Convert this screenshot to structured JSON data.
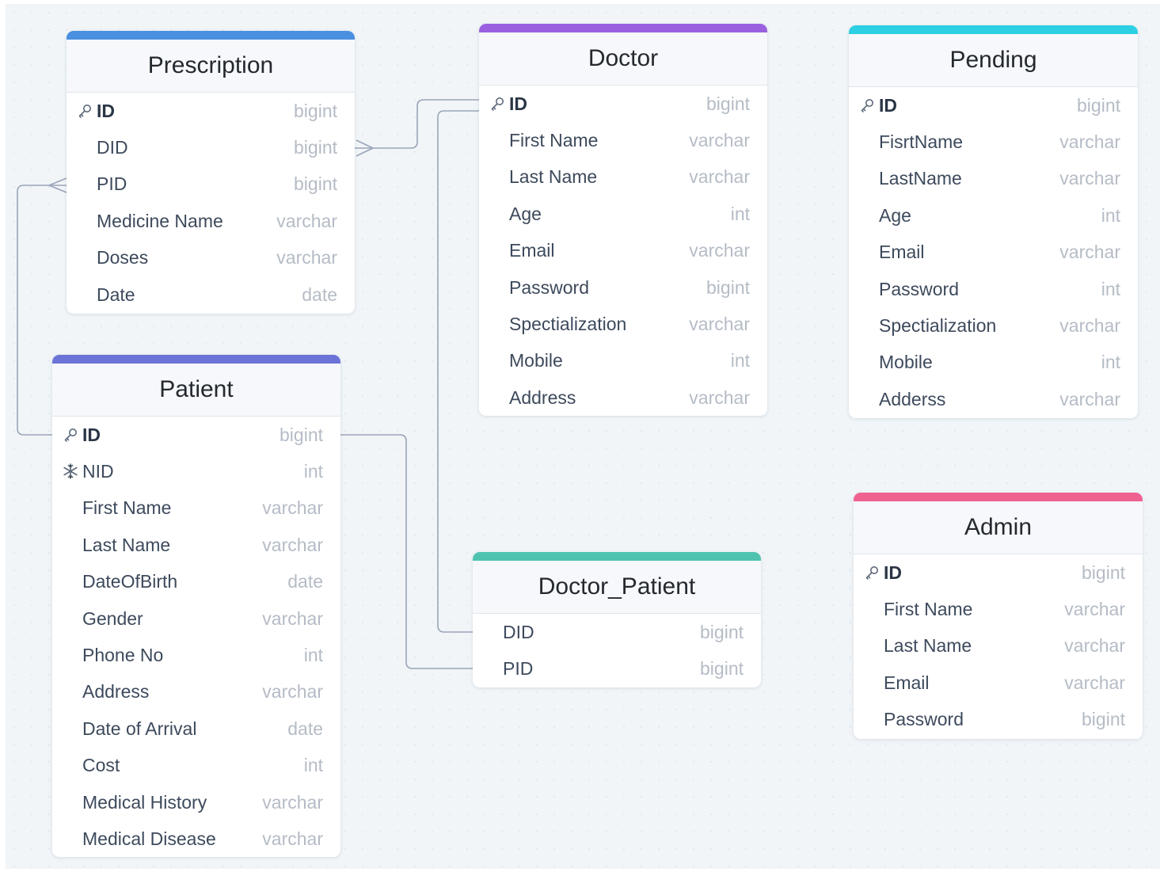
{
  "colors": {
    "background": "#f1f5f8",
    "connector": "#9aa5b8",
    "prescription": "#4a8fe0",
    "doctor": "#9a60e0",
    "pending": "#2ccfe3",
    "patient": "#6b74d6",
    "doctor_patient": "#4fc3b0",
    "admin": "#ef6190"
  },
  "tables": {
    "prescription": {
      "title": "Prescription",
      "fields": [
        {
          "name": "ID",
          "type": "bigint",
          "icon": "key-icon"
        },
        {
          "name": "DID",
          "type": "bigint"
        },
        {
          "name": "PID",
          "type": "bigint"
        },
        {
          "name": "Medicine Name",
          "type": "varchar"
        },
        {
          "name": "Doses",
          "type": "varchar"
        },
        {
          "name": "Date",
          "type": "date"
        }
      ]
    },
    "doctor": {
      "title": "Doctor",
      "fields": [
        {
          "name": "ID",
          "type": "bigint",
          "icon": "key-icon"
        },
        {
          "name": "First Name",
          "type": "varchar"
        },
        {
          "name": "Last Name",
          "type": "varchar"
        },
        {
          "name": "Age",
          "type": "int"
        },
        {
          "name": "Email",
          "type": "varchar"
        },
        {
          "name": "Password",
          "type": "bigint"
        },
        {
          "name": "Spectialization",
          "type": "varchar"
        },
        {
          "name": "Mobile",
          "type": "int"
        },
        {
          "name": "Address",
          "type": "varchar"
        }
      ]
    },
    "pending": {
      "title": "Pending",
      "fields": [
        {
          "name": "ID",
          "type": "bigint",
          "icon": "key-icon"
        },
        {
          "name": "FisrtName",
          "type": "varchar"
        },
        {
          "name": "LastName",
          "type": "varchar"
        },
        {
          "name": "Age",
          "type": "int"
        },
        {
          "name": "Email",
          "type": "varchar"
        },
        {
          "name": "Password",
          "type": "int"
        },
        {
          "name": "Spectialization",
          "type": "varchar"
        },
        {
          "name": "Mobile",
          "type": "int"
        },
        {
          "name": "Adderss",
          "type": "varchar"
        }
      ]
    },
    "patient": {
      "title": "Patient",
      "fields": [
        {
          "name": "ID",
          "type": "bigint",
          "icon": "key-icon"
        },
        {
          "name": "NID",
          "type": "int",
          "icon": "snowflake-icon"
        },
        {
          "name": "First Name",
          "type": "varchar"
        },
        {
          "name": "Last Name",
          "type": "varchar"
        },
        {
          "name": "DateOfBirth",
          "type": "date"
        },
        {
          "name": "Gender",
          "type": "varchar"
        },
        {
          "name": "Phone No",
          "type": "int"
        },
        {
          "name": "Address",
          "type": "varchar"
        },
        {
          "name": "Date of Arrival",
          "type": "date"
        },
        {
          "name": "Cost",
          "type": "int"
        },
        {
          "name": "Medical History",
          "type": "varchar"
        },
        {
          "name": "Medical Disease",
          "type": "varchar"
        }
      ]
    },
    "doctor_patient": {
      "title": "Doctor_Patient",
      "fields": [
        {
          "name": "DID",
          "type": "bigint"
        },
        {
          "name": "PID",
          "type": "bigint"
        }
      ]
    },
    "admin": {
      "title": "Admin",
      "fields": [
        {
          "name": "ID",
          "type": "bigint",
          "icon": "key-icon"
        },
        {
          "name": "First Name",
          "type": "varchar"
        },
        {
          "name": "Last Name",
          "type": "varchar"
        },
        {
          "name": "Email",
          "type": "varchar"
        },
        {
          "name": "Password",
          "type": "bigint"
        }
      ]
    }
  },
  "relationships": [
    {
      "from": "doctor.ID",
      "to": "prescription.DID",
      "cardinality": "one-to-many"
    },
    {
      "from": "patient.ID",
      "to": "prescription.PID",
      "cardinality": "one-to-many"
    },
    {
      "from": "doctor.ID",
      "to": "doctor_patient.DID",
      "cardinality": "one-to-one"
    },
    {
      "from": "patient.ID",
      "to": "doctor_patient.PID",
      "cardinality": "one-to-one"
    }
  ]
}
